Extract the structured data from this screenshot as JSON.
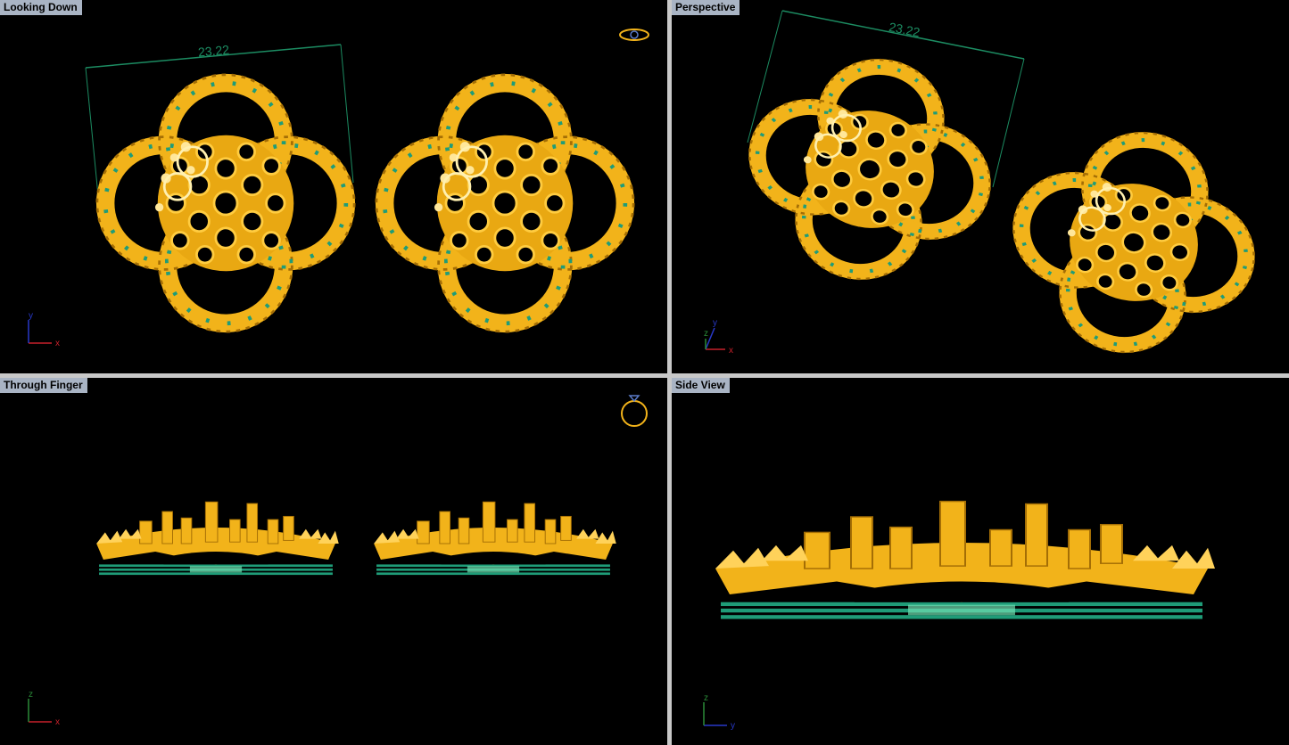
{
  "viewports": {
    "top": {
      "title": "Looking Down",
      "dimension": "23.22",
      "axes": {
        "h": "x",
        "v": "y"
      }
    },
    "perspective": {
      "title": "Perspective",
      "dimension": "23.22",
      "axes": {
        "h": "x",
        "v": "y",
        "d": "z"
      }
    },
    "front": {
      "title": "Through Finger",
      "axes": {
        "h": "x",
        "v": "z"
      }
    },
    "side": {
      "title": "Side View",
      "axes": {
        "h": "y",
        "v": "z"
      }
    }
  },
  "colors": {
    "background": "#000000",
    "separator": "#c8c8c8",
    "title_bar": "#a9b4c4",
    "gold": "#f2b31a",
    "gold_dark": "#a46e05",
    "gold_light": "#ffe79a",
    "gem_green": "#1f9c78",
    "dimension_line": "#1c8c62",
    "axis_x": "#c8202a",
    "axis_y": "#2838c8",
    "axis_z": "#2a8a38"
  }
}
